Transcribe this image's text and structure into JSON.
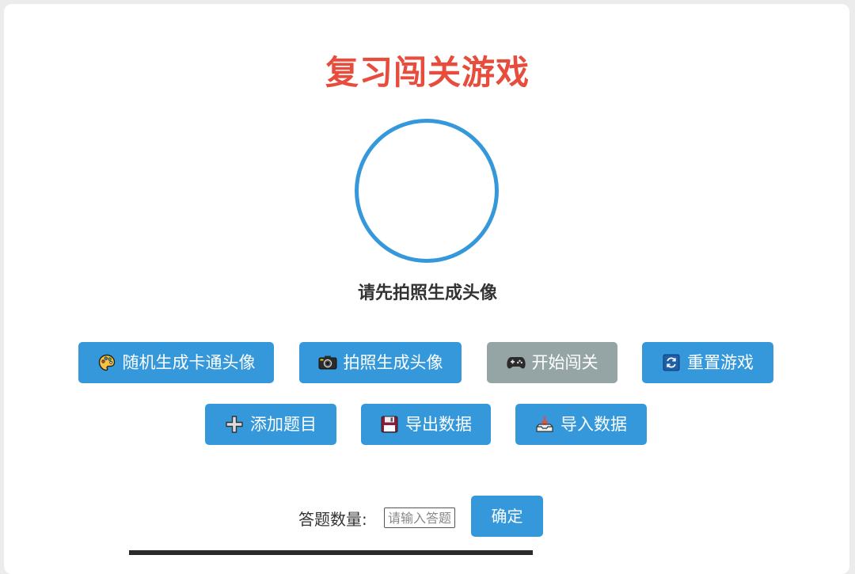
{
  "title": "复习闯关游戏",
  "avatar_hint": "请先拍照生成头像",
  "toolbar": {
    "random_avatar": "随机生成卡通头像",
    "photo_avatar": "拍照生成头像",
    "start_game": "开始闯关",
    "reset_game": "重置游戏",
    "add_question": "添加题目",
    "export_data": "导出数据",
    "import_data": "导入数据"
  },
  "question_count": {
    "label": "答题数量:",
    "placeholder": "请输入答题数量",
    "confirm": "确定"
  },
  "colors": {
    "primary": "#3498db",
    "disabled": "#95a5a6",
    "title": "#e74c3c"
  }
}
